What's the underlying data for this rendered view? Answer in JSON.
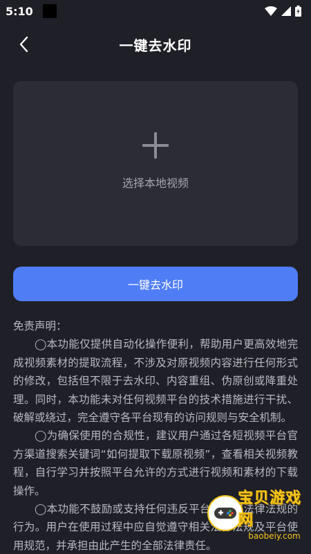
{
  "status_bar": {
    "time": "5:10"
  },
  "header": {
    "title": "一键去水印",
    "back_icon": "chevron-left-icon"
  },
  "upload": {
    "icon": "plus-icon",
    "label": "选择本地视频"
  },
  "actions": {
    "primary_label": "一键去水印"
  },
  "disclaimer": {
    "heading": "免责声明：",
    "paragraphs": [
      "◯本功能仅提供自动化操作便利，帮助用户更高效地完成视频素材的提取流程，不涉及对原视频内容进行任何形式的修改，包括但不限于去水印、内容重组、伪原创或降重处理。同时，本功能未对任何视频平台的技术措施进行干扰、破解或绕过，完全遵守各平台现有的访问规则与安全机制。",
      "◯为确保使用的合规性，建议用户通过各短视频平台官方渠道搜索关键词“如何提取下载原视频”，查看相关视频教程，自行学习并按照平台允许的方式进行视频和素材的下载操作。",
      "◯本功能不鼓励或支持任何违反平台规则或法律法规的行为。用户在使用过程中应自觉遵守相关法律法规及平台使用规范，并承担由此产生的全部法律责任。"
    ]
  },
  "watermark": {
    "title": "宝贝游戏网",
    "url": "baobeiy.com"
  },
  "colors": {
    "background": "#1f1f27",
    "card": "#2b2c36",
    "accent": "#4f7df6"
  }
}
